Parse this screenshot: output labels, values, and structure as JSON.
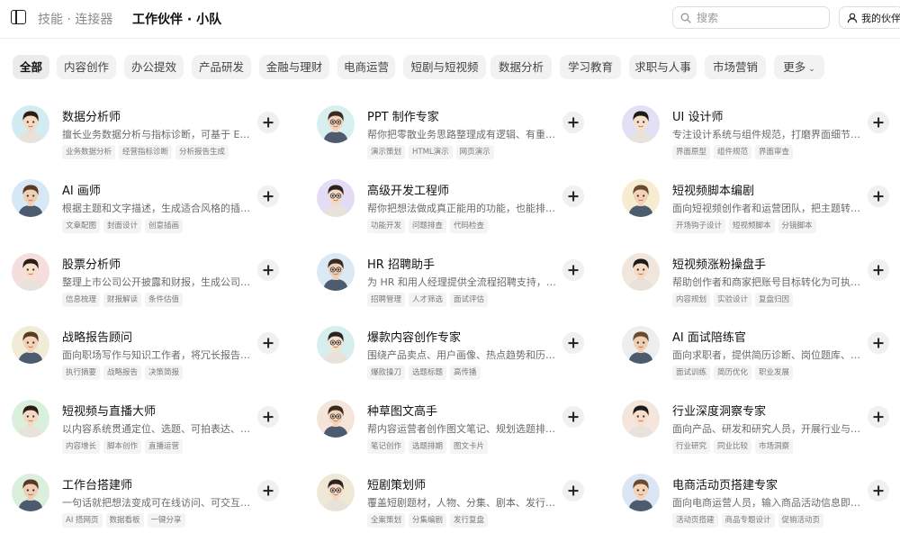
{
  "header": {
    "crumb_left": "技能 · 连接器",
    "crumb_current": "工作伙伴 · 小队",
    "search_placeholder": "搜索",
    "my_partners_label": "我的伙伴"
  },
  "filters": {
    "items": [
      {
        "label": "全部",
        "active": true
      },
      {
        "label": "内容创作"
      },
      {
        "label": "办公提效"
      },
      {
        "label": "产品研发"
      },
      {
        "label": "金融与理财"
      },
      {
        "label": "电商运营"
      },
      {
        "label": "短剧与短视频"
      },
      {
        "label": "数据分析"
      },
      {
        "label": "学习教育"
      },
      {
        "label": "求职与人事"
      },
      {
        "label": "市场营销"
      },
      {
        "label": "更多"
      }
    ]
  },
  "agents": [
    {
      "name": "数据分析师",
      "desc": "擅长业务数据分析与指标诊断，可基于 Excel 数据快速生成分析报告",
      "tags": [
        "业务数据分析",
        "经营指标诊断",
        "分析报告生成"
      ],
      "avatar_bg": "#d3ecf2"
    },
    {
      "name": "PPT 制作专家",
      "desc": "帮你把零散业务思路整理成有逻辑、有重点的演示文稿",
      "tags": [
        "演示策划",
        "HTML演示",
        "网页演示"
      ],
      "avatar_bg": "#d8eff0"
    },
    {
      "name": "UI 设计师",
      "desc": "专注设计系统与组件规范，打磨界面细节与交互体验",
      "tags": [
        "界面原型",
        "组件规范",
        "界面审查"
      ],
      "avatar_bg": "#e2e0f4"
    },
    {
      "name": "AI 画师",
      "desc": "根据主题和文字描述，生成适合风格的插画与配图",
      "tags": [
        "文章配图",
        "封面设计",
        "创意插画"
      ],
      "avatar_bg": "#d6e8f5"
    },
    {
      "name": "高级开发工程师",
      "desc": "帮你把想法做成真正能用的功能，也能排查代码问题",
      "tags": [
        "功能开发",
        "问题排查",
        "代码检查"
      ],
      "avatar_bg": "#e4dcf5"
    },
    {
      "name": "短视频脚本编剧",
      "desc": "面向短视频创作者和运营团队，把主题转化为可拍摄脚本",
      "tags": [
        "开场钩子设计",
        "短视频脚本",
        "分镜脚本"
      ],
      "avatar_bg": "#f5ecd2"
    },
    {
      "name": "股票分析师",
      "desc": "整理上市公司公开披露和财报，生成公司分析与估值",
      "tags": [
        "信息梳理",
        "财报解读",
        "条件估值"
      ],
      "avatar_bg": "#f5dede"
    },
    {
      "name": "HR 招聘助手",
      "desc": "为 HR 和用人经理提供全流程招聘支持，提升招聘效率",
      "tags": [
        "招聘管理",
        "人才筛选",
        "面试评估"
      ],
      "avatar_bg": "#dbe9f4"
    },
    {
      "name": "短视频涨粉操盘手",
      "desc": "帮助创作者和商家把账号目标转化为可执行的涨粉方案",
      "tags": [
        "内容规划",
        "实验设计",
        "复盘归因"
      ],
      "avatar_bg": "#f0e6dc"
    },
    {
      "name": "战略报告顾问",
      "desc": "面向职场写作与知识工作者，将冗长报告提炼为决策简报",
      "tags": [
        "执行摘要",
        "战略报告",
        "决策简报"
      ],
      "avatar_bg": "#f0ecd8"
    },
    {
      "name": "爆款内容创作专家",
      "desc": "围绕产品卖点、用户画像、热点趋势和历史数据打造爆款",
      "tags": [
        "爆款操刀",
        "选题标题",
        "高传播"
      ],
      "avatar_bg": "#d7eeee"
    },
    {
      "name": "AI 面试陪练官",
      "desc": "面向求职者，提供简历诊断、岗位题库、模拟面试训练",
      "tags": [
        "面试训练",
        "简历优化",
        "职业发展"
      ],
      "avatar_bg": "#eeeeee"
    },
    {
      "name": "短视频与直播大师",
      "desc": "以内容系统贯通定位、选题、可拍表达、直播转化",
      "tags": [
        "内容增长",
        "脚本创作",
        "直播运营"
      ],
      "avatar_bg": "#daf0dc"
    },
    {
      "name": "种草图文高手",
      "desc": "帮内容运营者创作图文笔记、规划选题排期与图文卡片",
      "tags": [
        "笔记创作",
        "选题排期",
        "图文卡片"
      ],
      "avatar_bg": "#f4e4da"
    },
    {
      "name": "行业深度洞察专家",
      "desc": "面向产品、研发和研究人员，开展行业与竞品深度研究",
      "tags": [
        "行业研究",
        "同业比较",
        "市场洞察"
      ],
      "avatar_bg": "#f4e6dc"
    },
    {
      "name": "工作台搭建师",
      "desc": "一句话就把想法变成可在线访问、可交互的网页工作台",
      "tags": [
        "AI 搭网页",
        "数据看板",
        "一键分享"
      ],
      "avatar_bg": "#daf0dc"
    },
    {
      "name": "短剧策划师",
      "desc": "覆盖短剧题材，人物、分集、剧本、发行全流程策划",
      "tags": [
        "全案策划",
        "分集编剧",
        "发行复盘"
      ],
      "avatar_bg": "#f0e8d6"
    },
    {
      "name": "电商活动页搭建专家",
      "desc": "面向电商运营人员，输入商品活动信息即可生成活动页",
      "tags": [
        "活动页搭建",
        "商品专题设计",
        "促销活动页"
      ],
      "avatar_bg": "#dbe6f4"
    }
  ]
}
